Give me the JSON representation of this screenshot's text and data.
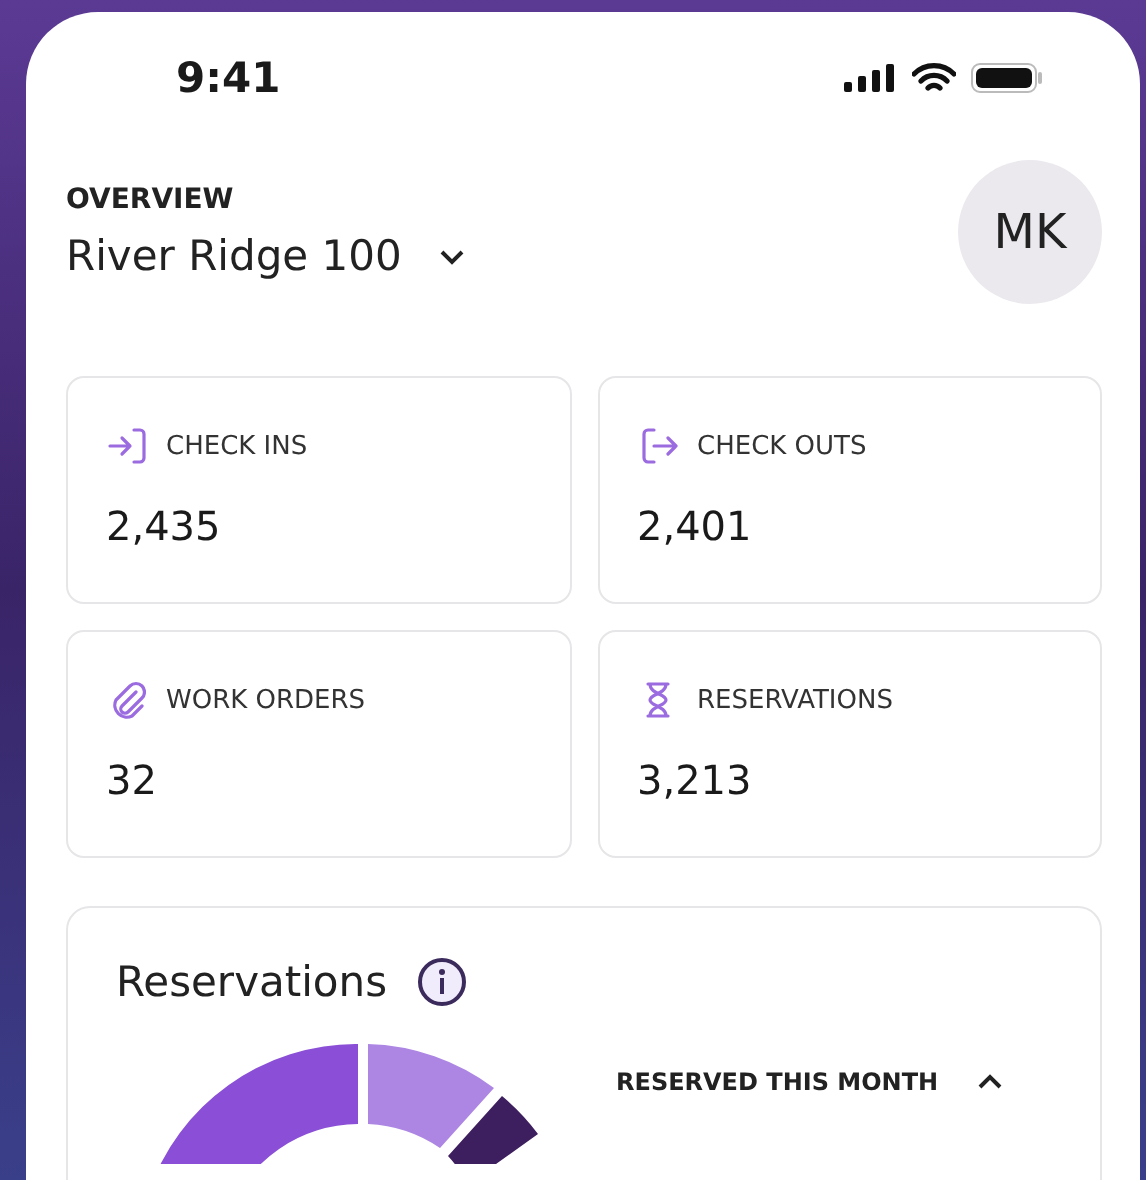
{
  "status_bar": {
    "time": "9:41"
  },
  "header": {
    "eyebrow": "OVERVIEW",
    "property": "River Ridge 100",
    "avatar": "MK"
  },
  "stats": [
    {
      "kind": "check-in",
      "label": "CHECK INS",
      "value": "2,435"
    },
    {
      "kind": "check-out",
      "label": "CHECK OUTS",
      "value": "2,401"
    },
    {
      "kind": "work-order",
      "label": "WORK ORDERS",
      "value": "32"
    },
    {
      "kind": "reservation",
      "label": "RESERVATIONS",
      "value": "3,213"
    }
  ],
  "reservations": {
    "title": "Reservations",
    "legend_title": "RESERVED THIS MONTH",
    "legend_expanded": true
  }
}
